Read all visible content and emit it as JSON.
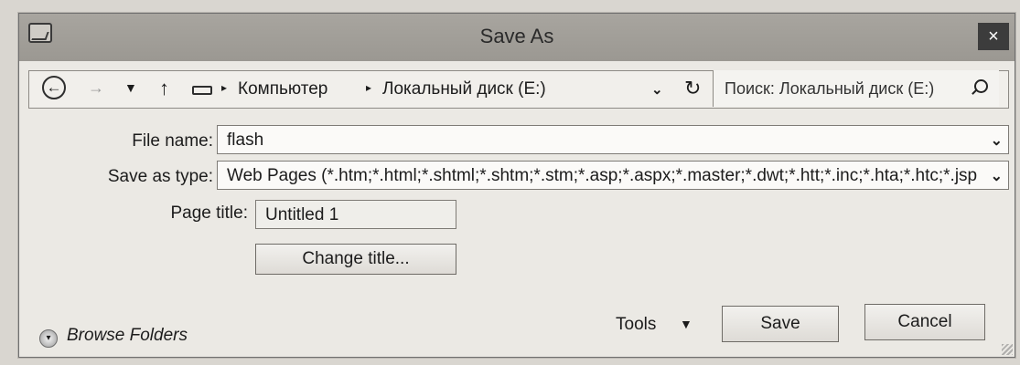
{
  "window": {
    "title": "Save As",
    "close_glyph": "×"
  },
  "nav": {
    "back_glyph": "←",
    "forward_glyph": "→",
    "recent_glyph": "▼",
    "up_glyph": "↑",
    "sep_glyph": "▸",
    "breadcrumbs": [
      "Компьютер",
      "Локальный диск (E:)"
    ],
    "dropdown_glyph": "⌄",
    "refresh_glyph": "↻",
    "search_placeholder": "Поиск: Локальный диск (E:)"
  },
  "form": {
    "file_name_label": "File name:",
    "file_name_value": "flash",
    "save_type_label": "Save as type:",
    "save_type_value": "Web Pages (*.htm;*.html;*.shtml;*.shtm;*.stm;*.asp;*.aspx;*.master;*.dwt;*.htt;*.inc;*.hta;*.htc;*.jsp",
    "page_title_label": "Page title:",
    "page_title_value": "Untitled 1",
    "change_title_button": "Change title..."
  },
  "footer": {
    "browse_folders": "Browse Folders",
    "tools_label": "Tools",
    "save_button": "Save",
    "cancel_button": "Cancel"
  },
  "icons": {
    "window": "app-window-icon",
    "close": "close-icon",
    "back": "back-arrow-icon",
    "forward": "forward-arrow-icon",
    "up": "up-arrow-icon",
    "drive": "drive-icon",
    "refresh": "refresh-icon",
    "search": "search-icon",
    "browse": "expand-circle-icon"
  }
}
